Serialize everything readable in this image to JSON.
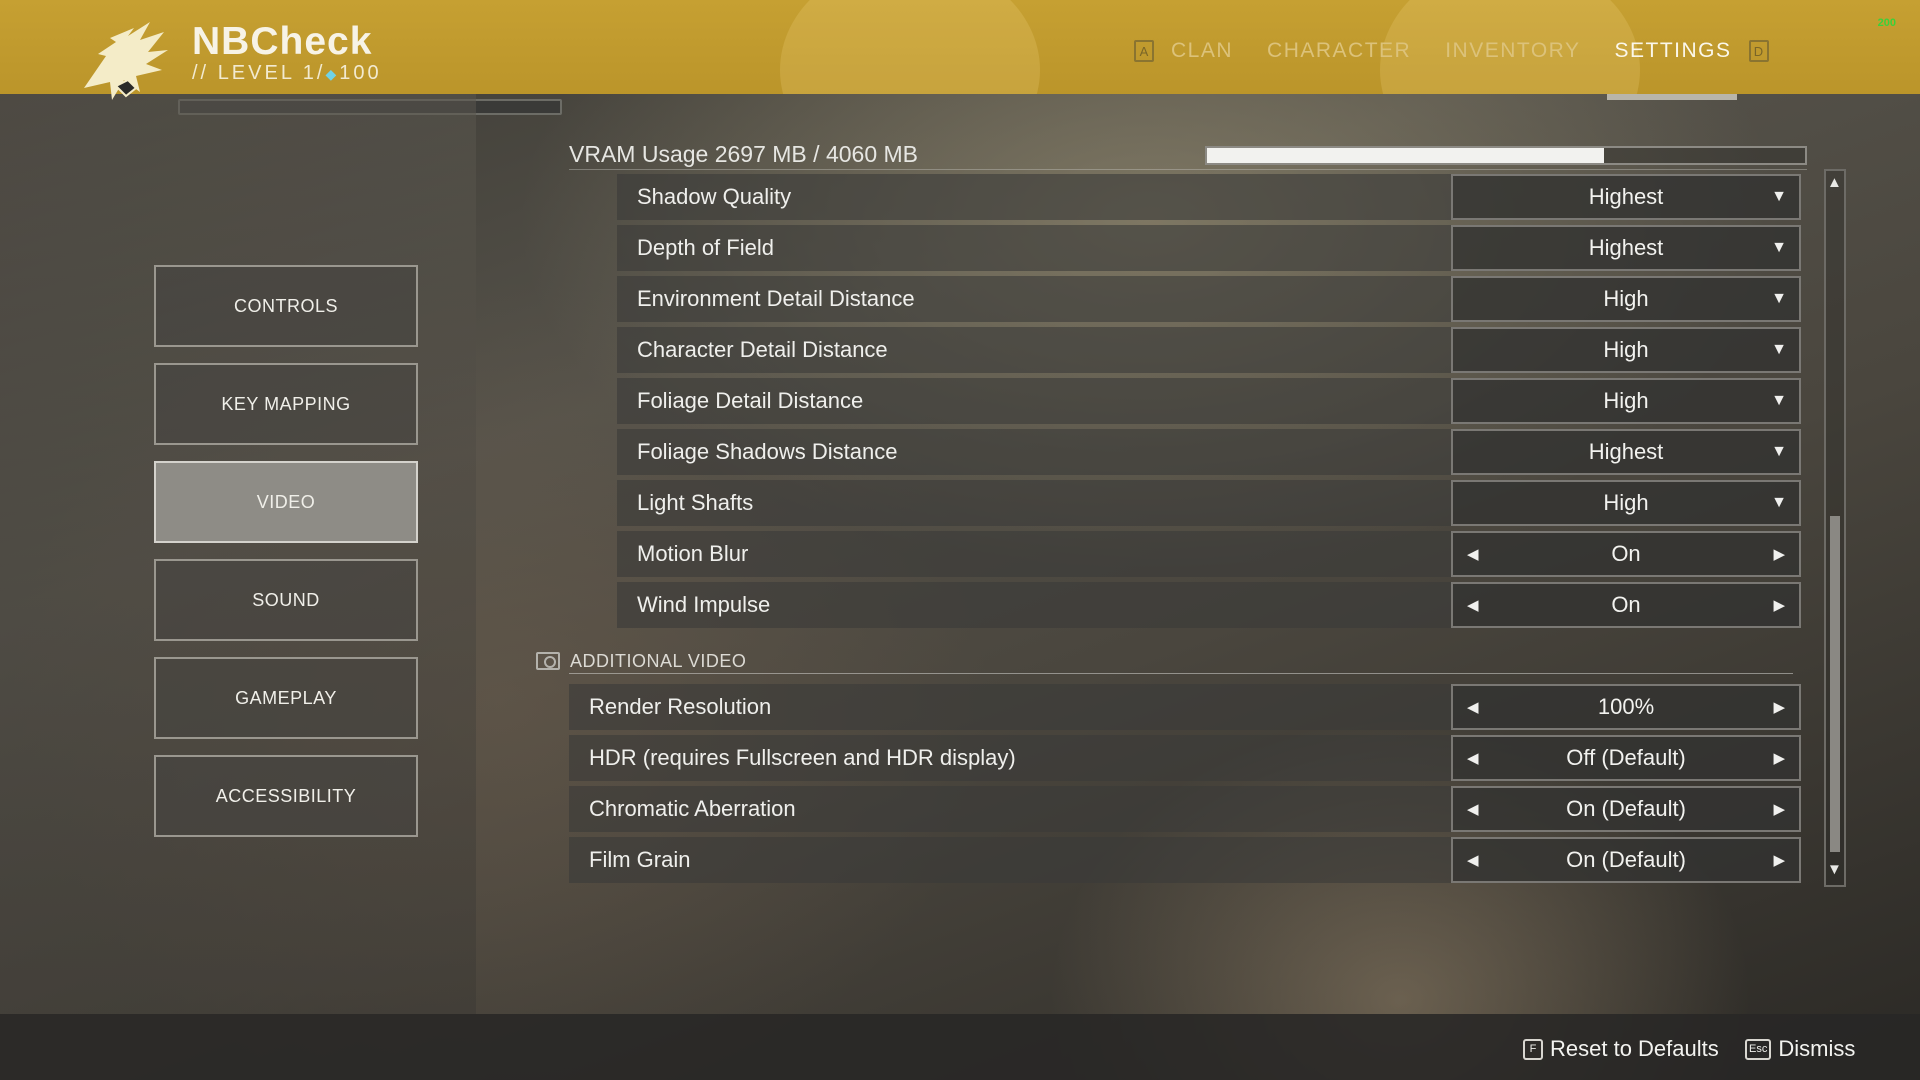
{
  "header": {
    "player_name": "NBCheck",
    "level_prefix": "//",
    "level_text": "LEVEL 1/",
    "level_max": "100",
    "tabs": {
      "left_key": "A",
      "clan": "CLAN",
      "character": "CHARACTER",
      "inventory": "INVENTORY",
      "settings": "SETTINGS",
      "right_key": "D"
    },
    "fps": "200",
    "accent_color": "#c6a032"
  },
  "sidebar": {
    "controls": "CONTROLS",
    "key_mapping": "KEY MAPPING",
    "video": "VIDEO",
    "sound": "SOUND",
    "gameplay": "GAMEPLAY",
    "accessibility": "ACCESSIBILITY",
    "selected": "VIDEO"
  },
  "vram": {
    "label": "VRAM Usage 2697 MB / 4060 MB",
    "fill_fraction": 0.664
  },
  "video_settings": {
    "shadow_quality": {
      "label": "Shadow Quality",
      "value": "Highest"
    },
    "depth_of_field": {
      "label": "Depth of Field",
      "value": "Highest"
    },
    "environment_detail": {
      "label": "Environment Detail Distance",
      "value": "High"
    },
    "character_detail": {
      "label": "Character Detail Distance",
      "value": "High"
    },
    "foliage_detail": {
      "label": "Foliage Detail Distance",
      "value": "High"
    },
    "foliage_shadows": {
      "label": "Foliage Shadows Distance",
      "value": "Highest"
    },
    "light_shafts": {
      "label": "Light Shafts",
      "value": "High"
    },
    "motion_blur": {
      "label": "Motion Blur",
      "value": "On"
    },
    "wind_impulse": {
      "label": "Wind Impulse",
      "value": "On"
    }
  },
  "additional_video": {
    "title": "ADDITIONAL VIDEO",
    "render_resolution": {
      "label": "Render Resolution",
      "value": "100%"
    },
    "hdr": {
      "label": "HDR (requires Fullscreen and HDR display)",
      "value": "Off (Default)"
    },
    "chromatic_aberration": {
      "label": "Chromatic Aberration",
      "value": "On (Default)"
    },
    "film_grain": {
      "label": "Film Grain",
      "value": "On (Default)"
    }
  },
  "footer": {
    "reset_key": "F",
    "reset_label": "Reset to Defaults",
    "dismiss_key": "Esc",
    "dismiss_label": "Dismiss"
  },
  "icons": {
    "dropdown": "chevron-down-icon",
    "arrow_left": "arrow-left-icon",
    "arrow_right": "arrow-right-icon",
    "scroll_up": "scroll-up-icon",
    "scroll_down": "scroll-down-icon"
  }
}
